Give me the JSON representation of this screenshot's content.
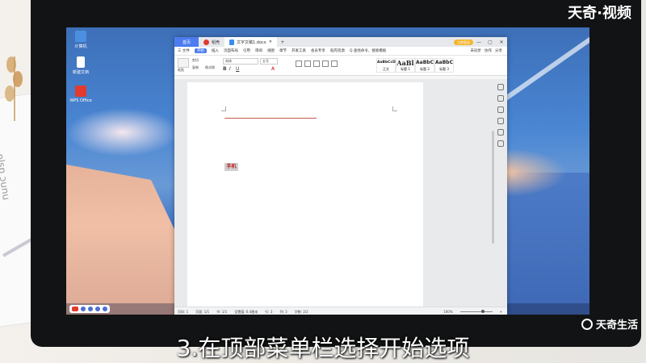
{
  "watermark": {
    "top_right": "天奇·视频",
    "bottom_right": "天奇生活"
  },
  "caption": "3.在顶部菜单栏选择开始选项",
  "desktop": {
    "icons": [
      {
        "label": "计算机",
        "color": "#4c8fe0"
      },
      {
        "label": "新建文档",
        "color": "#ffffff"
      },
      {
        "label": "WPS Office",
        "color": "#e03b2e"
      }
    ]
  },
  "window": {
    "tabs": {
      "home": "首页",
      "app": "稻壳",
      "doc": "文字文稿1.docx"
    },
    "login": "立即登录",
    "controls": {
      "min": "—",
      "max": "▢",
      "close": "✕",
      "add": "+"
    },
    "menu": {
      "file": "三 文件",
      "items": [
        "开始",
        "插入",
        "页面布局",
        "引用",
        "审阅",
        "视图",
        "章节",
        "开发工具",
        "会员专享",
        "稻壳资源"
      ],
      "search": "Q 查找命令、搜索模板",
      "right": [
        "未同步",
        "协作",
        "分享"
      ]
    },
    "ribbon": {
      "paste": "粘贴",
      "cut": "剪切",
      "copy": "复制",
      "format_painter": "格式刷",
      "font": "宋体",
      "size": "五号",
      "styles": [
        {
          "preview": "AaBbCcDd",
          "name": "正文"
        },
        {
          "preview": "AaBl",
          "name": "标题 1"
        },
        {
          "preview": "AaBbC",
          "name": "标题 2"
        },
        {
          "preview": "AaBbC",
          "name": "标题 3"
        }
      ]
    },
    "document": {
      "selected_text": "手机"
    },
    "status": {
      "page": "页码: 1",
      "pages": "页面: 1/1",
      "section": "节: 1/1",
      "setting": "设置值: 6.4厘米",
      "row": "行: 3",
      "col": "列: 3",
      "words": "字数: 2/2",
      "zoom": "100%"
    }
  }
}
